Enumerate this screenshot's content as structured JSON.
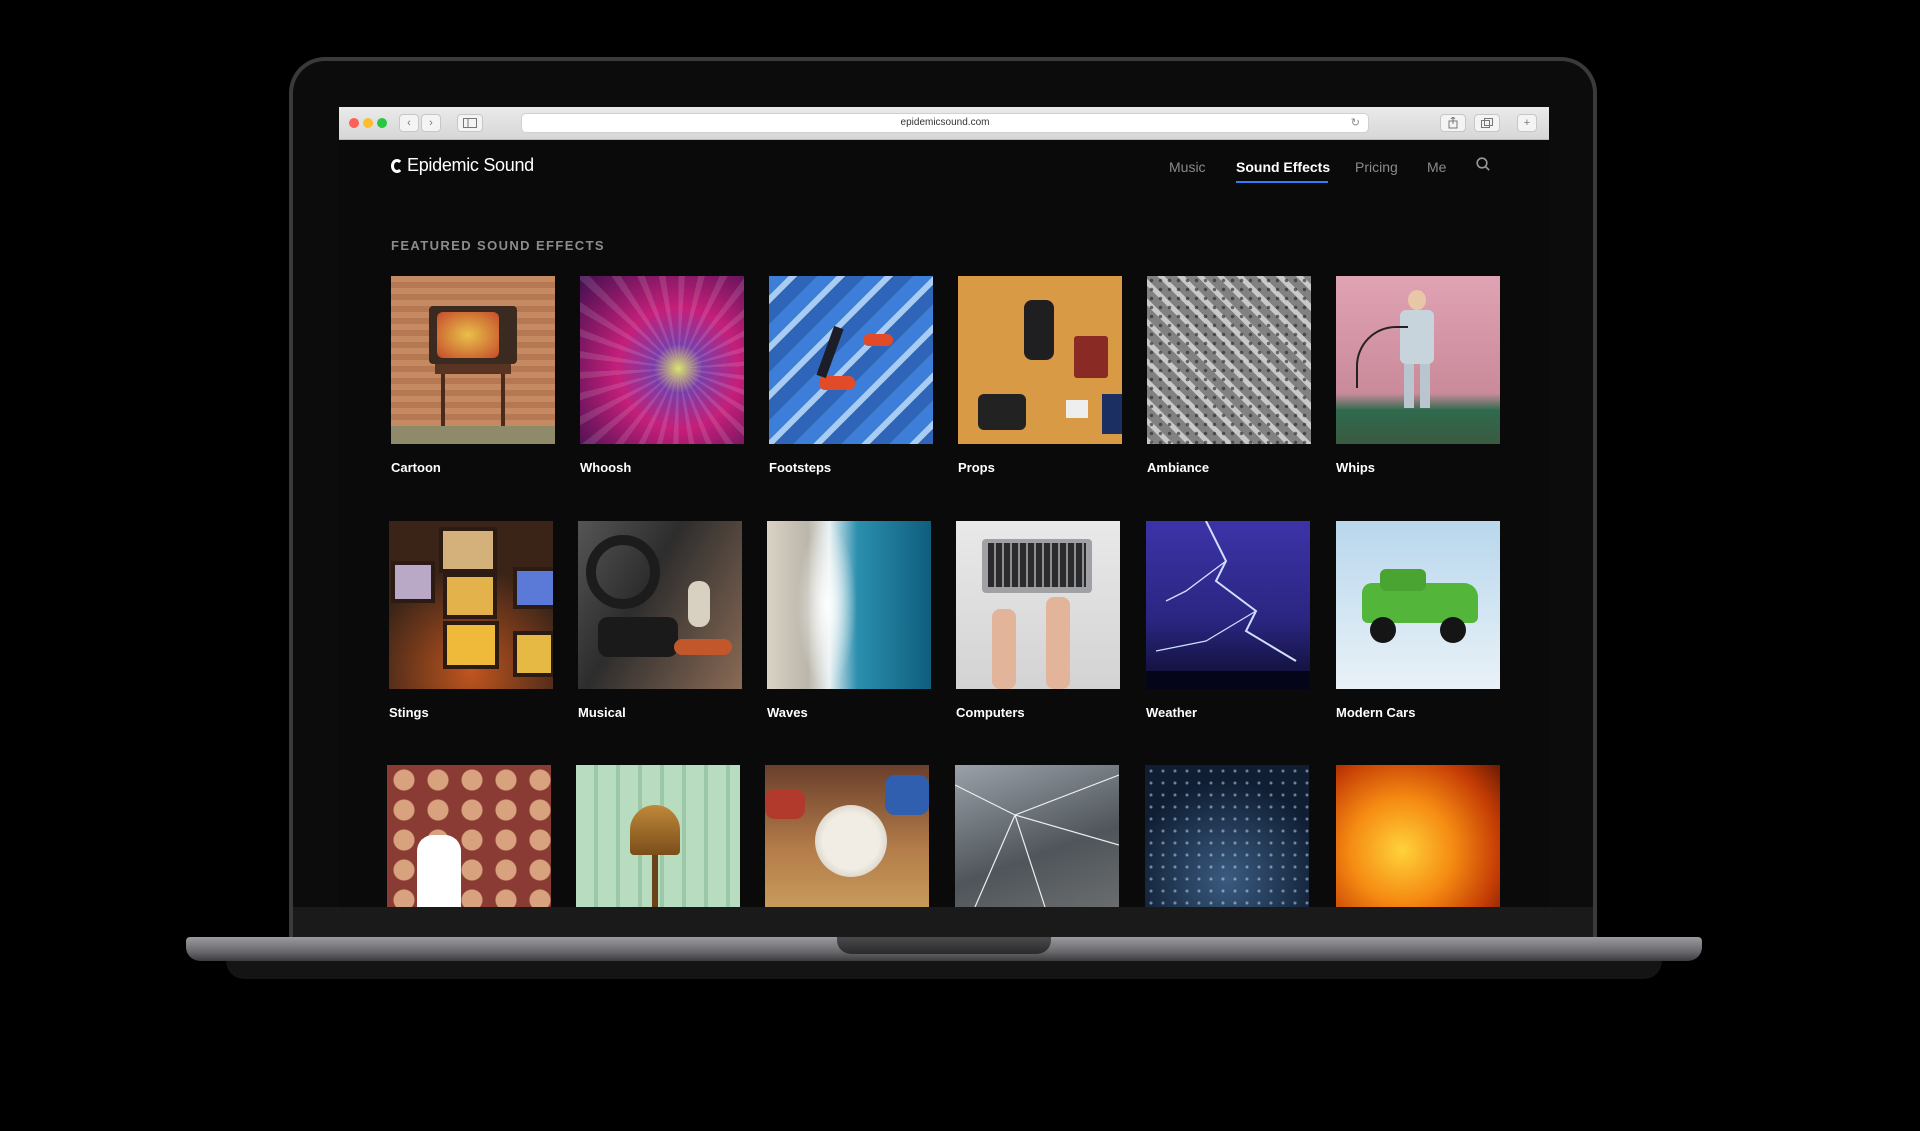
{
  "browser": {
    "url": "epidemicsound.com"
  },
  "site": {
    "logo_text": "Epidemic Sound",
    "nav": [
      {
        "label": "Music",
        "active": false
      },
      {
        "label": "Sound Effects",
        "active": true
      },
      {
        "label": "Pricing",
        "active": false
      },
      {
        "label": "Me",
        "active": false
      }
    ],
    "accent_color": "#2f7ef7"
  },
  "section": {
    "title": "FEATURED SOUND EFFECTS"
  },
  "categories": [
    {
      "label": "Cartoon"
    },
    {
      "label": "Whoosh"
    },
    {
      "label": "Footsteps"
    },
    {
      "label": "Props"
    },
    {
      "label": "Ambiance"
    },
    {
      "label": "Whips"
    },
    {
      "label": "Stings"
    },
    {
      "label": "Musical"
    },
    {
      "label": "Waves"
    },
    {
      "label": "Computers"
    },
    {
      "label": "Weather"
    },
    {
      "label": "Modern Cars"
    },
    {
      "label": ""
    },
    {
      "label": ""
    },
    {
      "label": ""
    },
    {
      "label": ""
    },
    {
      "label": ""
    },
    {
      "label": ""
    }
  ],
  "icons": {
    "search": "search-icon",
    "sidebar": "sidebar-icon",
    "back": "chevron-left-icon",
    "forward": "chevron-right-icon",
    "reload": "reload-icon",
    "share": "share-icon",
    "tabs": "tabs-icon"
  }
}
